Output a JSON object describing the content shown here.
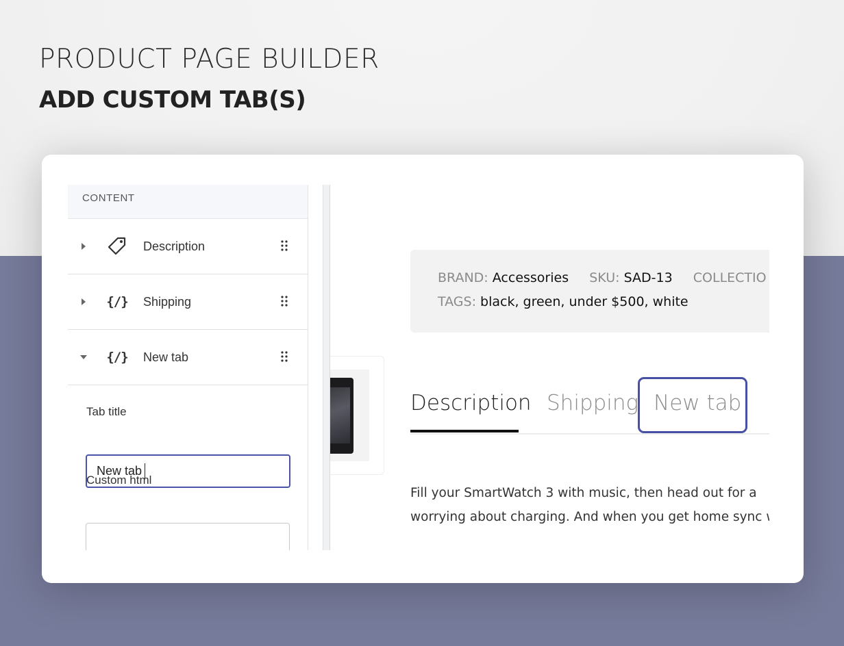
{
  "hero": {
    "title": "PRODUCT PAGE BUILDER",
    "subtitle": "ADD CUSTOM TAB(S)"
  },
  "sidebar": {
    "section_label": "CONTENT",
    "items": [
      {
        "label": "Description",
        "icon": "tag-icon",
        "expanded": false
      },
      {
        "label": "Shipping",
        "icon": "code-icon",
        "expanded": false
      },
      {
        "label": "New tab",
        "icon": "code-icon",
        "expanded": true
      }
    ],
    "code_glyph": "{/}",
    "form": {
      "tab_title_label": "Tab title",
      "tab_title_value": "New tab",
      "custom_html_label": "Custom html",
      "custom_html_value": ""
    }
  },
  "product": {
    "meta": {
      "brand_key": "BRAND:",
      "brand_value": "Accessories",
      "sku_key": "SKU:",
      "sku_value": "SAD-13",
      "collection_key": "COLLECTIO",
      "tags_key": "TAGS:",
      "tags_value": "black, green, under $500, white"
    },
    "tabs": [
      {
        "label": "Description",
        "active": true
      },
      {
        "label": "Shipping",
        "active": false
      },
      {
        "label": "New tab",
        "active": false,
        "highlighted": true
      }
    ],
    "description_lines": [
      "Fill your SmartWatch 3 with music, then head out for a",
      "worrying about charging. And when you get home sync with"
    ]
  },
  "colors": {
    "accent": "#4a53a8",
    "bottom_band": "#777b9b"
  }
}
